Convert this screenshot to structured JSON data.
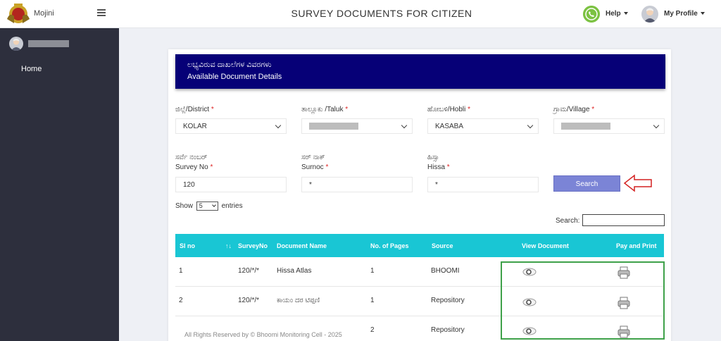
{
  "header": {
    "brand": "Mojini",
    "page_title": "SURVEY DOCUMENTS FOR CITIZEN",
    "help_label": "Help",
    "profile_label": "My Profile"
  },
  "sidebar": {
    "items": [
      {
        "label": "Home"
      }
    ]
  },
  "banner": {
    "title_kn": "ಲಭ್ಯವಿರುವ ದಾಖಲೆಗಳ ವಿವರಗಳು",
    "title_en": "Available Document Details"
  },
  "form": {
    "district": {
      "label": "ಜಿಲ್ಲೆ/District",
      "value": "KOLAR"
    },
    "taluk": {
      "label": "ತಾಲ್ಲೂಕು /Taluk",
      "value": ""
    },
    "hobli": {
      "label": "ಹೋಬಳಿ/Hobli",
      "value": "KASABA"
    },
    "village": {
      "label": "ಗ್ರಾಮ/Village",
      "value": ""
    },
    "survey_no": {
      "label_kn": "ಸರ್ವೆ ನಂಬರ್",
      "label": "Survey No",
      "value": "120"
    },
    "surnoc": {
      "label_kn": "ಸರ್ ನಾಕ್",
      "label": "Surnoc",
      "value": "*"
    },
    "hissa": {
      "label_kn": "ಹಿಸ್ಸಾ",
      "label": "Hissa",
      "value": "*"
    },
    "required_mark": "*",
    "search_button": "Search"
  },
  "table_controls": {
    "show_label": "Show",
    "entries_value": "5",
    "entries_label": "entries",
    "search_label": "Search:"
  },
  "table": {
    "columns": [
      "Sl no",
      "SurveyNo",
      "Document Name",
      "No. of Pages",
      "Source",
      "View Document",
      "Pay and Print"
    ],
    "rows": [
      {
        "sl": "1",
        "survey_no": "120/*/*",
        "doc_name": "Hissa Atlas",
        "pages": "1",
        "source": "BHOOMI"
      },
      {
        "sl": "2",
        "survey_no": "120/*/*",
        "doc_name": "ಕಾಯಂ ದರ ಟಿಪ್ಪಣಿ",
        "pages": "1",
        "source": "Repository"
      },
      {
        "sl": "",
        "survey_no": "",
        "doc_name": "",
        "pages": "2",
        "source": "Repository"
      }
    ]
  },
  "footer": {
    "text": "All Rights Reserved by © Bhoomi Monitoring Cell - 2025"
  },
  "colors": {
    "banner": "#060077",
    "table_header": "#19c6d4",
    "search_button": "#7b84d6",
    "sidebar": "#2d2f3d",
    "highlight": "#3fa14a",
    "arrow": "#d42020"
  }
}
